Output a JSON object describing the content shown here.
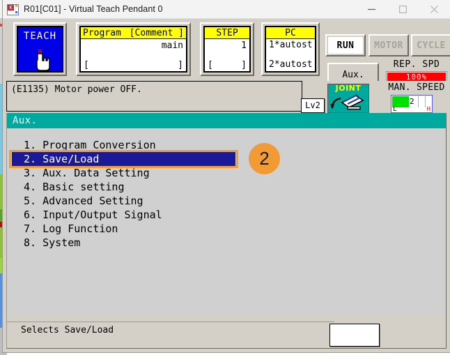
{
  "window": {
    "title": "R01[C01] - Virtual Teach Pendant 0",
    "icon": "app-robot-icon",
    "controls": {
      "minimize": "minimize-icon",
      "maximize": "maximize-icon",
      "close": "close-icon"
    }
  },
  "pendant": {
    "teach": {
      "label": "TEACH",
      "icon": "hand-pointer-icon"
    },
    "program": {
      "header_left": "Program",
      "header_right": "[Comment ]",
      "value": "main",
      "bracket_left": "[",
      "bracket_right": "]"
    },
    "step": {
      "header": "STEP",
      "value": "1",
      "bracket_left": "[",
      "bracket_right": "]"
    },
    "pc": {
      "header": "PC",
      "line1": "1*autost",
      "line2": "2*autost"
    },
    "lamps": {
      "run": "RUN",
      "motor": "MOTOR",
      "cycle": "CYCLE"
    },
    "aux_button": "Aux.",
    "rep_spd": {
      "label": "REP. SPD",
      "value": "100%",
      "color": "#ff0000"
    },
    "man_speed": {
      "label": "MAN. SPEED",
      "value": "2",
      "low_marker": "L",
      "high_marker": "H",
      "fill_color": "#00e000"
    },
    "message": "(E1135) Motor power OFF.",
    "level_badge": "Lv2",
    "joint": {
      "label": "JOINT",
      "icon": "robot-arm-joint-icon",
      "color": "#00a99d"
    }
  },
  "screen": {
    "title": "Aux.",
    "title_color": "#00a99d",
    "selection_ring_color": "#f29d38",
    "selection_row_color": "#1a1a99",
    "menu": [
      {
        "num": "1.",
        "label": "Program Conversion",
        "selected": false
      },
      {
        "num": "2.",
        "label": "Save/Load",
        "selected": true
      },
      {
        "num": "3.",
        "label": "Aux. Data Setting",
        "selected": false
      },
      {
        "num": "4.",
        "label": "Basic setting",
        "selected": false
      },
      {
        "num": "5.",
        "label": "Advanced Setting",
        "selected": false
      },
      {
        "num": "6.",
        "label": "Input/Output Signal",
        "selected": false
      },
      {
        "num": "7.",
        "label": "Log Function",
        "selected": false
      },
      {
        "num": "8.",
        "label": "System",
        "selected": false
      }
    ],
    "step_badge": "2"
  },
  "bottom": {
    "hint": "Selects Save/Load",
    "input_value": ""
  }
}
